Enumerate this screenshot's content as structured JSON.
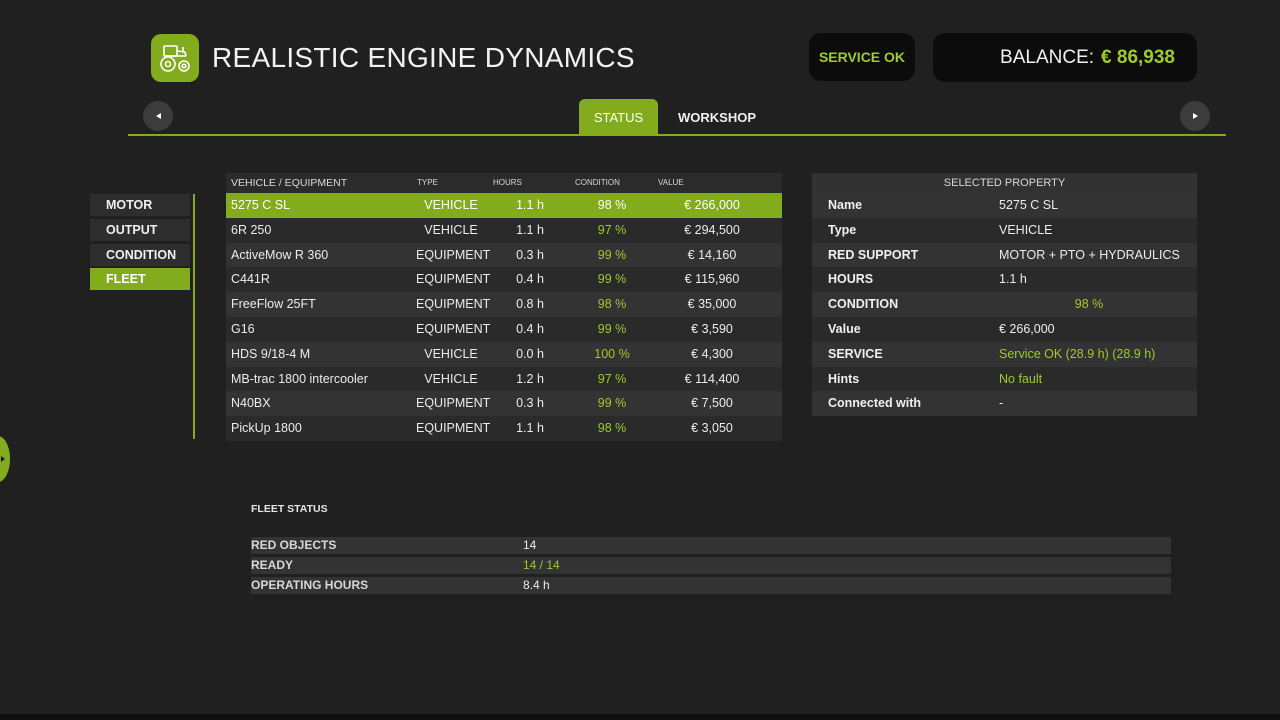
{
  "header": {
    "title": "REALISTIC ENGINE DYNAMICS",
    "logo_icon": "tractor-icon",
    "service_status": "SERVICE OK",
    "balance_label": "BALANCE:",
    "balance_value": "€ 86,938"
  },
  "tabs": [
    {
      "label": "STATUS",
      "active": true
    },
    {
      "label": "WORKSHOP",
      "active": false
    }
  ],
  "side_menu": [
    {
      "label": "MOTOR",
      "active": false
    },
    {
      "label": "OUTPUT",
      "active": false
    },
    {
      "label": "CONDITION",
      "active": false
    },
    {
      "label": "FLEET",
      "active": true
    }
  ],
  "fleet_table": {
    "columns": {
      "name": "VEHICLE / EQUIPMENT",
      "type": "TYPE",
      "hours": "HOURS",
      "condition": "CONDITION",
      "value": "VALUE"
    },
    "rows": [
      {
        "name": "5275 C SL",
        "type": "VEHICLE",
        "hours": "1.1 h",
        "condition": "98 %",
        "value": "€ 266,000",
        "selected": true
      },
      {
        "name": "6R 250",
        "type": "VEHICLE",
        "hours": "1.1 h",
        "condition": "97 %",
        "value": "€ 294,500"
      },
      {
        "name": "ActiveMow R 360",
        "type": "EQUIPMENT",
        "hours": "0.3 h",
        "condition": "99 %",
        "value": "€ 14,160"
      },
      {
        "name": "C441R",
        "type": "EQUIPMENT",
        "hours": "0.4 h",
        "condition": "99 %",
        "value": "€ 115,960"
      },
      {
        "name": "FreeFlow 25FT",
        "type": "EQUIPMENT",
        "hours": "0.8 h",
        "condition": "98 %",
        "value": "€ 35,000"
      },
      {
        "name": "G16",
        "type": "EQUIPMENT",
        "hours": "0.4 h",
        "condition": "99 %",
        "value": "€ 3,590"
      },
      {
        "name": "HDS 9/18-4 M",
        "type": "VEHICLE",
        "hours": "0.0 h",
        "condition": "100 %",
        "value": "€ 4,300"
      },
      {
        "name": "MB-trac 1800 intercooler",
        "type": "VEHICLE",
        "hours": "1.2 h",
        "condition": "97 %",
        "value": "€ 114,400"
      },
      {
        "name": "N40BX",
        "type": "EQUIPMENT",
        "hours": "0.3 h",
        "condition": "99 %",
        "value": "€ 7,500"
      },
      {
        "name": "PickUp 1800",
        "type": "EQUIPMENT",
        "hours": "1.1 h",
        "condition": "98 %",
        "value": "€ 3,050"
      }
    ]
  },
  "details": {
    "title": "SELECTED PROPERTY",
    "rows": [
      {
        "key": "Name",
        "value": "5275 C SL"
      },
      {
        "key": "Type",
        "value": "VEHICLE"
      },
      {
        "key": "RED SUPPORT",
        "value": "MOTOR + PTO + HYDRAULICS"
      },
      {
        "key": "HOURS",
        "value": "1.1 h"
      },
      {
        "key": "CONDITION",
        "value": "98 %",
        "green": true,
        "center": true
      },
      {
        "key": "Value",
        "value": "€ 266,000"
      },
      {
        "key": "SERVICE",
        "value": "Service OK (28.9 h) (28.9 h)",
        "green": true
      },
      {
        "key": "Hints",
        "value": "No fault",
        "green": true
      },
      {
        "key": "Connected with",
        "value": "-"
      }
    ]
  },
  "fleet_status": {
    "title": "FLEET STATUS",
    "rows": [
      {
        "key": "RED OBJECTS",
        "value": "14"
      },
      {
        "key": "READY",
        "value": "14 / 14",
        "green": true
      },
      {
        "key": "OPERATING HOURS",
        "value": "8.4 h"
      }
    ]
  },
  "colors": {
    "accent": "#82ac1e",
    "accent_text": "#9fcb2a",
    "background": "#202020"
  }
}
